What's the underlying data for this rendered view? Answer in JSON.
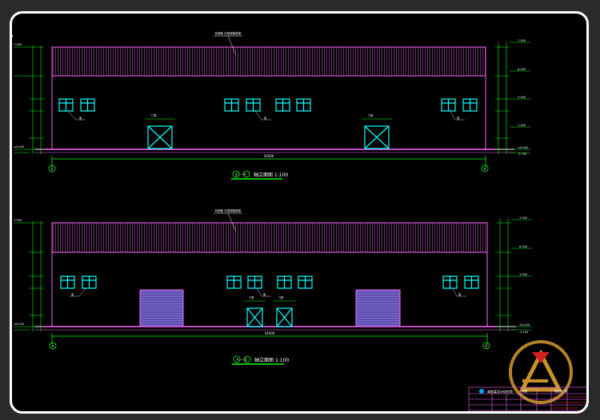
{
  "drawing": {
    "elev1": {
      "title_axes": "E — A",
      "title_text": "轴立面图 1:100",
      "roof_note": "彩钢板 压型钢板屋面",
      "dim_total": "54000",
      "axis_left": "E",
      "axis_right": "A",
      "elev_top": "7.500",
      "elev_eave": "6.000",
      "elev_win": "3.900",
      "elev_sill": "1.200",
      "elev_zero": "±0.000",
      "elev_ground": "-0.150",
      "door_note": "门洞",
      "win_note": "窗"
    },
    "elev2": {
      "title_axes": "A — E",
      "title_text": "轴立面图 1:100",
      "roof_note": "彩钢板 压型钢板屋面",
      "dim_total": "54000",
      "axis_left": "A",
      "axis_right": "E",
      "elev_top": "7.500",
      "elev_eave": "6.000",
      "elev_win": "3.900",
      "elev_sill": "1.200",
      "elev_zero": "±0.000",
      "elev_ground": "-0.150",
      "door_note": "门洞",
      "win_note": "窗"
    },
    "title_block": {
      "institute": "湖南某设计研究院",
      "project": "钢结构厂房",
      "sheet": "建施"
    }
  },
  "colors": {
    "frame": "#ffffff",
    "outline": "#ff66ff",
    "window": "#00ffff",
    "dimension": "#00ff00",
    "text": "#ffffff",
    "shutter": "#5f4fb0",
    "logo_gold": "#c8932a",
    "logo_red": "#d12020"
  }
}
